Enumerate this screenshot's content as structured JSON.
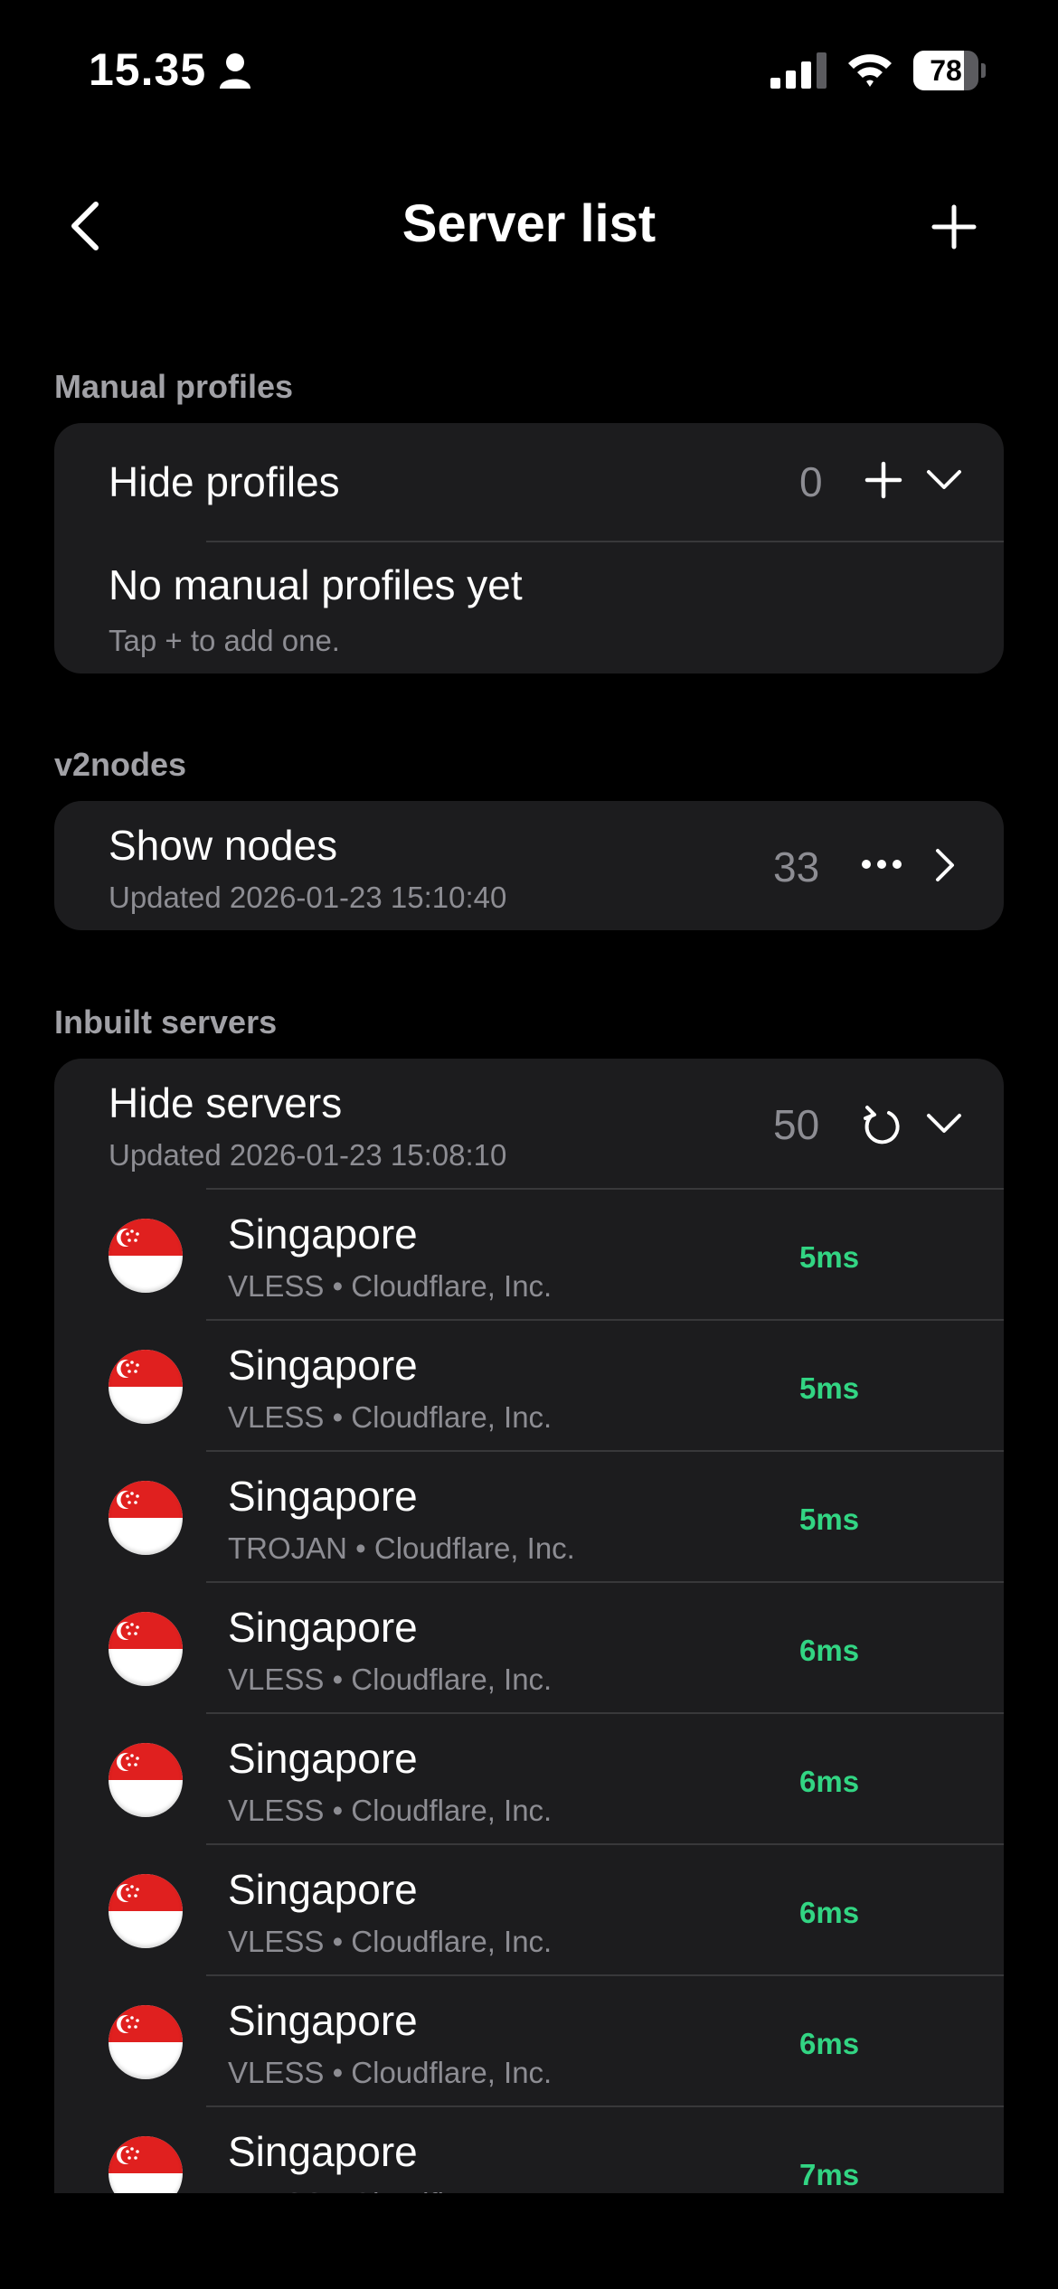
{
  "status_bar": {
    "time": "15.35",
    "battery": "78",
    "battery_level": 0.78
  },
  "nav": {
    "title": "Server list"
  },
  "manual": {
    "section_label": "Manual profiles",
    "toggle_label": "Hide profiles",
    "count": "0",
    "empty_title": "No manual profiles yet",
    "empty_hint": "Tap + to add one."
  },
  "v2nodes": {
    "section_label": "v2nodes",
    "title": "Show nodes",
    "updated": "Updated 2026-01-23 15:10:40",
    "count": "33"
  },
  "inbuilt": {
    "section_label": "Inbuilt servers",
    "title": "Hide servers",
    "updated": "Updated 2026-01-23 15:08:10",
    "count": "50",
    "servers": [
      {
        "name": "Singapore",
        "meta": "VLESS • Cloudflare, Inc.",
        "ping": "5ms"
      },
      {
        "name": "Singapore",
        "meta": "VLESS • Cloudflare, Inc.",
        "ping": "5ms"
      },
      {
        "name": "Singapore",
        "meta": "TROJAN • Cloudflare, Inc.",
        "ping": "5ms"
      },
      {
        "name": "Singapore",
        "meta": "VLESS • Cloudflare, Inc.",
        "ping": "6ms"
      },
      {
        "name": "Singapore",
        "meta": "VLESS • Cloudflare, Inc.",
        "ping": "6ms"
      },
      {
        "name": "Singapore",
        "meta": "VLESS • Cloudflare, Inc.",
        "ping": "6ms"
      },
      {
        "name": "Singapore",
        "meta": "VLESS • Cloudflare, Inc.",
        "ping": "6ms"
      },
      {
        "name": "Singapore",
        "meta": "VLESS • Cloudflare, Inc.",
        "ping": "7ms"
      }
    ]
  },
  "colors": {
    "accent_ping": "#32d583",
    "card": "#1c1c1e",
    "background": "#000000"
  }
}
